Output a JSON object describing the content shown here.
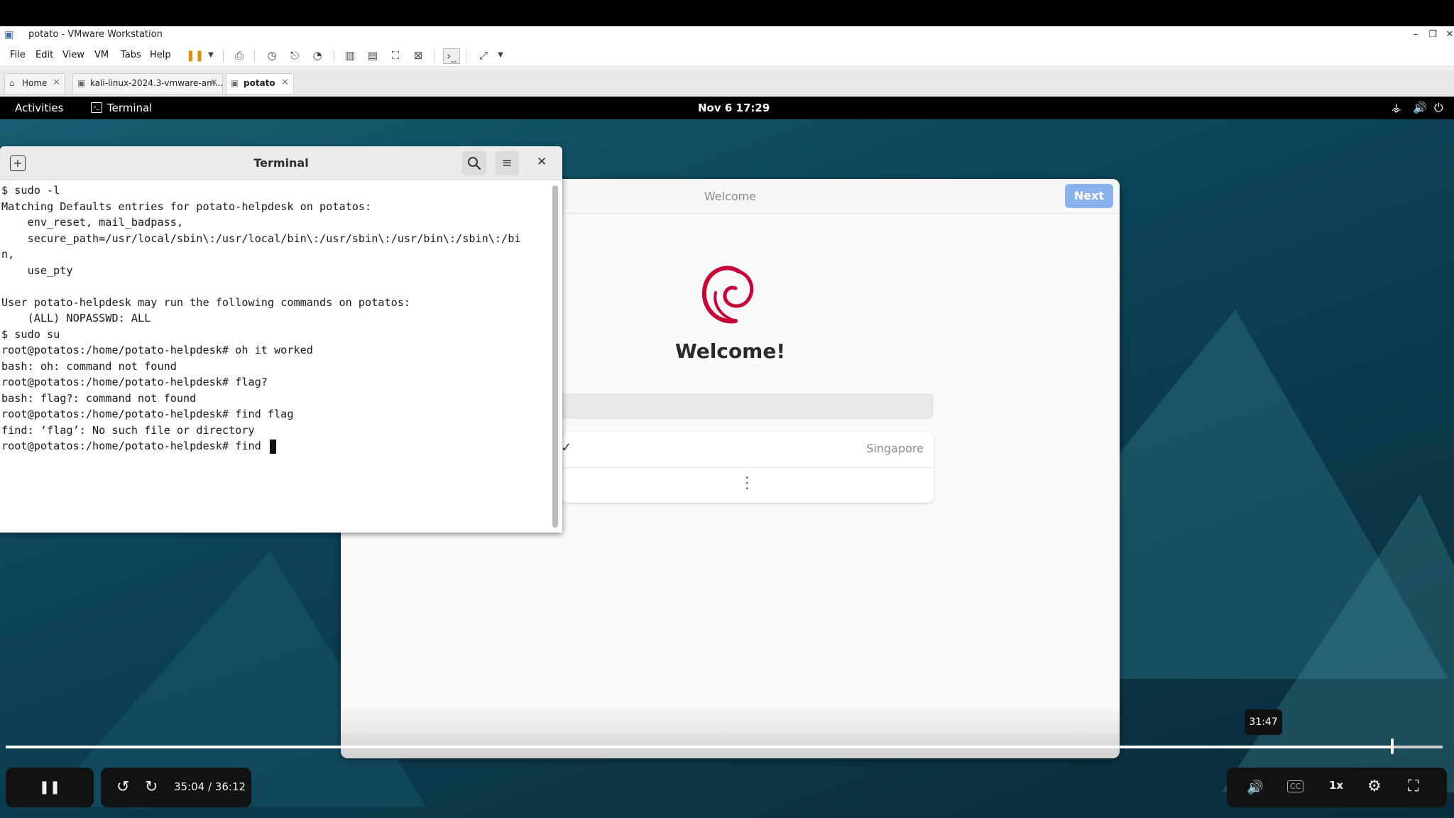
{
  "vmware": {
    "title": "potato - VMware Workstation",
    "menu": [
      "File",
      "Edit",
      "View",
      "VM",
      "Tabs",
      "Help"
    ],
    "tabs": [
      {
        "label": "Home",
        "icon": "home-icon"
      },
      {
        "label": "kali-linux-2024.3-vmware-am...",
        "icon": "vm-icon"
      },
      {
        "label": "potato",
        "icon": "vm-icon",
        "active": true
      }
    ]
  },
  "gnome": {
    "activities": "Activities",
    "app_menu": "Terminal",
    "clock": "Nov 6  17:29"
  },
  "welcome": {
    "title": "Welcome",
    "next_label": "Next",
    "heading": "Welcome!",
    "language_selected": "Singapore"
  },
  "terminal": {
    "title": "Terminal",
    "lines": [
      "$ sudo -l",
      "Matching Defaults entries for potato-helpdesk on potatos:",
      "    env_reset, mail_badpass,",
      "    secure_path=/usr/local/sbin\\:/usr/local/bin\\:/usr/sbin\\:/usr/bin\\:/sbin\\:/bi",
      "n,",
      "    use_pty",
      "",
      "User potato-helpdesk may run the following commands on potatos:",
      "    (ALL) NOPASSWD: ALL",
      "$ sudo su",
      "root@potatos:/home/potato-helpdesk# oh it worked",
      "bash: oh: command not found",
      "root@potatos:/home/potato-helpdesk# flag?",
      "bash: flag?: command not found",
      "root@potatos:/home/potato-helpdesk# find flag",
      "find: ‘flag’: No such file or directory",
      "root@potatos:/home/potato-helpdesk# find "
    ]
  },
  "player": {
    "hover_time": "31:47",
    "time": "35:04 / 36:12",
    "speed": "1x",
    "progress": 0.965
  }
}
